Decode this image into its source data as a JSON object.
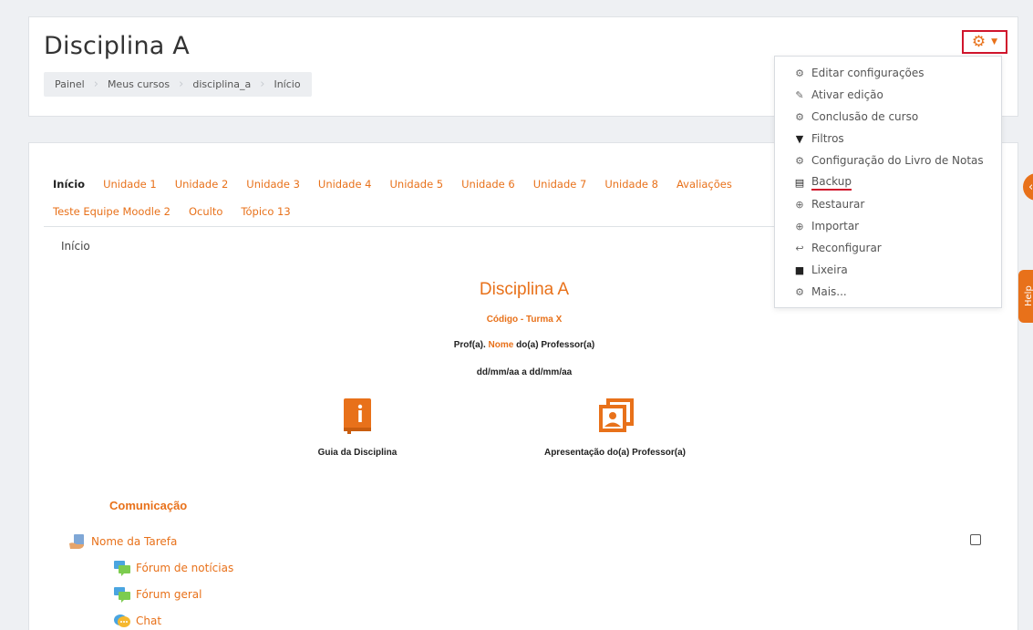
{
  "header": {
    "title": "Disciplina A",
    "breadcrumb": [
      "Painel",
      "Meus cursos",
      "disciplina_a",
      "Início"
    ]
  },
  "settings_menu": {
    "items": [
      {
        "label": "Editar configurações",
        "icon": "gear-icon"
      },
      {
        "label": "Ativar edição",
        "icon": "pencil-icon"
      },
      {
        "label": "Conclusão de curso",
        "icon": "gear-icon"
      },
      {
        "label": "Filtros",
        "icon": "filter-icon"
      },
      {
        "label": "Configuração do Livro de Notas",
        "icon": "gear-icon"
      },
      {
        "label": "Backup",
        "icon": "file-icon"
      },
      {
        "label": "Restaurar",
        "icon": "upload-icon"
      },
      {
        "label": "Importar",
        "icon": "upload-icon"
      },
      {
        "label": "Reconfigurar",
        "icon": "reply-icon"
      },
      {
        "label": "Lixeira",
        "icon": "trash-icon"
      },
      {
        "label": "Mais...",
        "icon": "gear-icon"
      }
    ]
  },
  "tabs": {
    "row1": [
      "Início",
      "Unidade 1",
      "Unidade 2",
      "Unidade 3",
      "Unidade 4",
      "Unidade 5",
      "Unidade 6",
      "Unidade 7",
      "Unidade 8",
      "Avaliações"
    ],
    "row2": [
      "Teste Equipe Moodle 2",
      "Oculto",
      "Tópico 13"
    ],
    "active": "Início"
  },
  "section": {
    "label": "Início",
    "course_title": "Disciplina A",
    "course_code": "Código - Turma X",
    "prof_prefix": "Prof(a).",
    "prof_name": "Nome",
    "prof_suffix": "do(a) Professor(a)",
    "dates": "dd/mm/aa a dd/mm/aa"
  },
  "resources": {
    "guide": "Guia da Disciplina",
    "presentation": "Apresentação do(a) Professor(a)"
  },
  "communication": {
    "title": "Comunicação",
    "activities": [
      "Nome da Tarefa",
      "Fórum de notícias",
      "Fórum geral",
      "Chat"
    ]
  },
  "side": {
    "help": "Help"
  },
  "colors": {
    "accent": "#e8711a",
    "highlight": "#d0152c"
  }
}
